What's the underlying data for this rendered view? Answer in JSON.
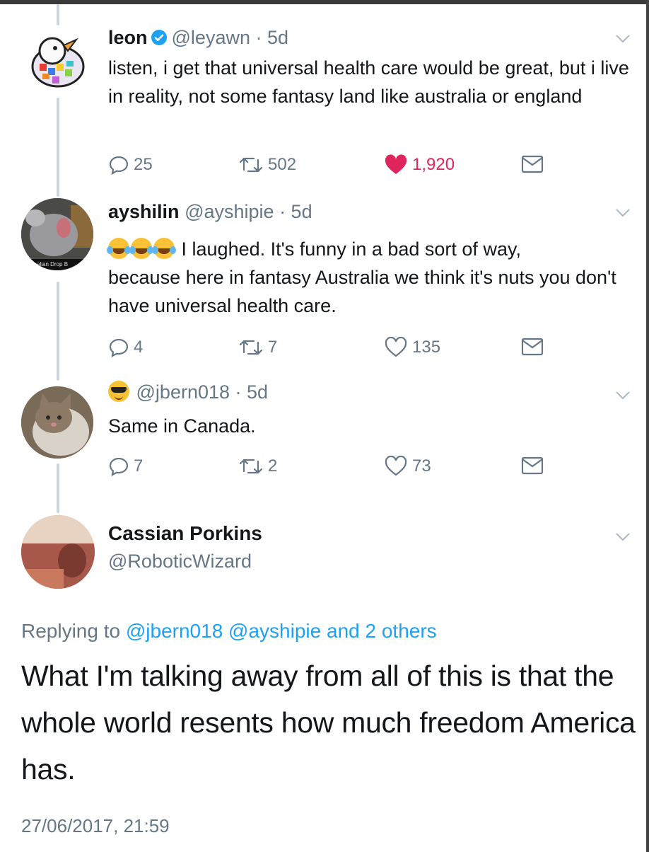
{
  "tweets": [
    {
      "name": "leon",
      "handle": "@leyawn",
      "time": "· 5d",
      "text": "listen, i get that universal health care would be great, but i live in reality, not some fantasy land like australia or england",
      "replies": "25",
      "retweets": "502",
      "likes": "1,920",
      "liked": true,
      "verified": true
    },
    {
      "name": "ayshilin",
      "handle": "@ayshipie",
      "time": "· 5d",
      "emoji_prefix": [
        "rolling-on-floor-laughing",
        "rolling-on-floor-laughing",
        "rolling-on-floor-laughing"
      ],
      "text_line1": "I laughed. It's funny in a bad sort of way,",
      "text_rest": "because here in fantasy Australia we think it's nuts you don't have universal health care.",
      "replies": "4",
      "retweets": "7",
      "likes": "135",
      "avatar_caption": "alian Drop B"
    },
    {
      "name_emoji": "smiling-face-with-sunglasses",
      "handle": "@jbern018",
      "time": "· 5d",
      "text": "Same in Canada.",
      "replies": "7",
      "retweets": "2",
      "likes": "73"
    }
  ],
  "main_tweet": {
    "name": "Cassian Porkins",
    "handle": "@RoboticWizard",
    "replying_prefix": "Replying to",
    "replying_mentions": "@jbern018 @ayshipie and 2 others",
    "text": "What I'm talking away from all of this is that the whole world resents how much freedom America has.",
    "timestamp": "27/06/2017, 21:59"
  },
  "colors": {
    "accent": "#1da1f2",
    "like": "#e0245e",
    "secondary_text": "#657786",
    "thread_line": "#ccd6dd"
  }
}
